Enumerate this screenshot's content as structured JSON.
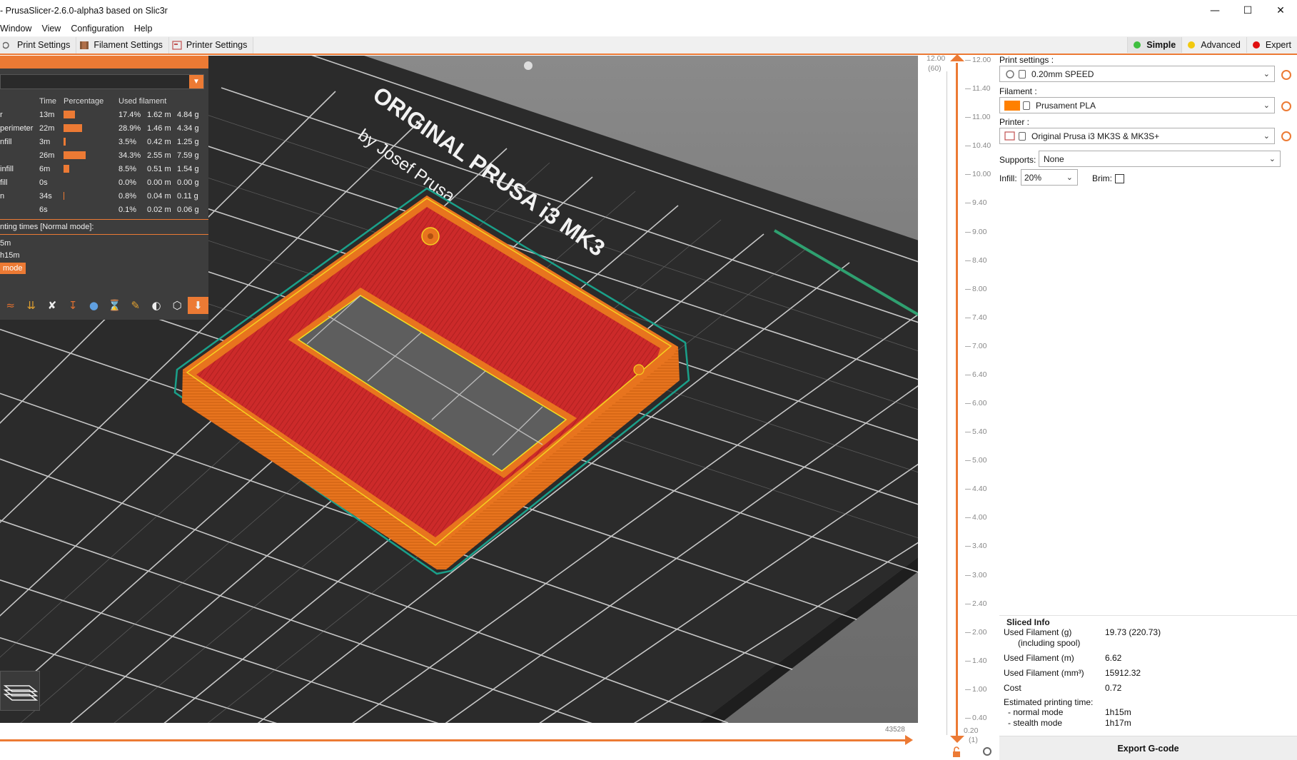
{
  "window": {
    "title": "- PrusaSlicer-2.6.0-alpha3 based on Slic3r",
    "minimize": "—",
    "maximize": "☐",
    "close": "✕"
  },
  "menu": [
    {
      "label": "Window"
    },
    {
      "label": "View"
    },
    {
      "label": "Configuration"
    },
    {
      "label": "Help"
    }
  ],
  "tabs": [
    {
      "label": "Print Settings"
    },
    {
      "label": "Filament Settings"
    },
    {
      "label": "Printer Settings"
    }
  ],
  "modes": [
    {
      "label": "Simple",
      "color": "#3fbf3f",
      "active": true
    },
    {
      "label": "Advanced",
      "color": "#f2c90f",
      "active": false
    },
    {
      "label": "Expert",
      "color": "#e01010",
      "active": false
    }
  ],
  "legend": {
    "headers": {
      "time": "Time",
      "percentage": "Percentage",
      "used": "Used filament"
    },
    "rows": [
      {
        "name": "r",
        "time": "13m",
        "pct": "17.4%",
        "pct_value": 17.4,
        "m": "1.62 m",
        "g": "4.84 g"
      },
      {
        "name": "perimeter",
        "time": "22m",
        "pct": "28.9%",
        "pct_value": 28.9,
        "m": "1.46 m",
        "g": "4.34 g"
      },
      {
        "name": "nfill",
        "time": "3m",
        "pct": "3.5%",
        "pct_value": 3.5,
        "m": "0.42 m",
        "g": "1.25 g"
      },
      {
        "name": "",
        "time": "26m",
        "pct": "34.3%",
        "pct_value": 34.3,
        "m": "2.55 m",
        "g": "7.59 g"
      },
      {
        "name": "infill",
        "time": "6m",
        "pct": "8.5%",
        "pct_value": 8.5,
        "m": "0.51 m",
        "g": "1.54 g"
      },
      {
        "name": "fill",
        "time": "0s",
        "pct": "0.0%",
        "pct_value": 0.0,
        "m": "0.00 m",
        "g": "0.00 g"
      },
      {
        "name": "n",
        "time": "34s",
        "pct": "0.8%",
        "pct_value": 0.8,
        "m": "0.04 m",
        "g": "0.11 g"
      },
      {
        "name": "",
        "time": "6s",
        "pct": "0.1%",
        "pct_value": 0.1,
        "m": "0.02 m",
        "g": "0.06 g"
      }
    ],
    "times_label": "nting times [Normal mode]:",
    "time1": "5m",
    "time2": "h15m",
    "mode_button": "mode"
  },
  "viewport": {
    "bed_text_main": "ORIGINAL PRUSA i3 MK3",
    "bed_text_by": "by Josef Prusa"
  },
  "hslider": {
    "value": "43528"
  },
  "vslider": {
    "top_value": "12.00",
    "top_layer": "(60)",
    "bottom_value": "0.20",
    "bottom_layer": "(1)",
    "ticks": [
      "12.00",
      "11.40",
      "11.00",
      "10.40",
      "10.00",
      "9.40",
      "9.00",
      "8.40",
      "8.00",
      "7.40",
      "7.00",
      "6.40",
      "6.00",
      "5.40",
      "5.00",
      "4.40",
      "4.00",
      "3.40",
      "3.00",
      "2.40",
      "2.00",
      "1.40",
      "1.00",
      "0.40"
    ]
  },
  "sidebar": {
    "print_label": "Print settings :",
    "print_value": "0.20mm SPEED",
    "filament_label": "Filament :",
    "filament_value": "Prusament PLA",
    "filament_color": "#ff8000",
    "printer_label": "Printer :",
    "printer_value": "Original Prusa i3 MK3S & MK3S+",
    "supports_label": "Supports:",
    "supports_value": "None",
    "infill_label": "Infill:",
    "infill_value": "20%",
    "brim_label": "Brim:"
  },
  "sliced_info": {
    "title": "Sliced Info",
    "used_g_label": "Used Filament (g)",
    "used_g_sub": "(including spool)",
    "used_g_value": "19.73 (220.73)",
    "used_m_label": "Used Filament (m)",
    "used_m_value": "6.62",
    "used_mm3_label": "Used Filament (mm³)",
    "used_mm3_value": "15912.32",
    "cost_label": "Cost",
    "cost_value": "0.72",
    "est_label": "Estimated printing time:",
    "normal_label": "- normal mode",
    "normal_value": "1h15m",
    "stealth_label": "- stealth mode",
    "stealth_value": "1h17m"
  },
  "export_label": "Export G-code",
  "accent": "#ec7a34"
}
